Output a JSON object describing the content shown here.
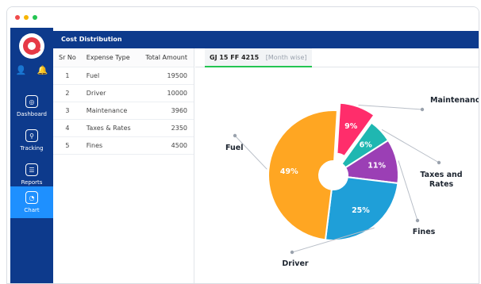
{
  "window": {
    "title": "Cost Distribution"
  },
  "sidebar": {
    "items": [
      {
        "label": "Dashboard",
        "icon": "speedometer-icon"
      },
      {
        "label": "Tracking",
        "icon": "map-pin-icon"
      },
      {
        "label": "Reports",
        "icon": "document-icon"
      },
      {
        "label": "Chart",
        "icon": "pie-chart-icon",
        "active": true
      }
    ],
    "top_icons": [
      "user-icon",
      "notification-icon"
    ]
  },
  "table": {
    "headers": [
      "Sr No",
      "Expense Type",
      "Total Amount"
    ],
    "rows": [
      {
        "sr": "1",
        "type": "Fuel",
        "amount": "19500"
      },
      {
        "sr": "2",
        "type": "Driver",
        "amount": "10000"
      },
      {
        "sr": "3",
        "type": "Maintenance",
        "amount": "3960"
      },
      {
        "sr": "4",
        "type": "Taxes & Rates",
        "amount": "2350"
      },
      {
        "sr": "5",
        "type": "Fines",
        "amount": "4500"
      }
    ]
  },
  "tab": {
    "vehicle": "GJ 15 FF 4215",
    "mode": "[Month wise]"
  },
  "chart_data": {
    "type": "pie",
    "slices": [
      {
        "name": "Maintenance",
        "label": "Maintenance",
        "pct_label": "9%",
        "value": 9,
        "color": "#ff2d6b",
        "exploded": true
      },
      {
        "name": "Taxes and Rates",
        "label": "Taxes and\nRates",
        "pct_label": "6%",
        "value": 6,
        "color": "#1fb7b1"
      },
      {
        "name": "Fines",
        "label": "Fines",
        "pct_label": "11%",
        "value": 11,
        "color": "#9b3fb5"
      },
      {
        "name": "Driver",
        "label": "Driver",
        "pct_label": "25%",
        "value": 25,
        "color": "#1f9fd8"
      },
      {
        "name": "Fuel",
        "label": "Fuel",
        "pct_label": "49%",
        "value": 49,
        "color": "#ffa622"
      }
    ]
  },
  "colors": {
    "sidebar": "#0d3a8c",
    "active": "#1e90ff",
    "header": "#0d3a8c",
    "tab_underline": "#23c552"
  }
}
